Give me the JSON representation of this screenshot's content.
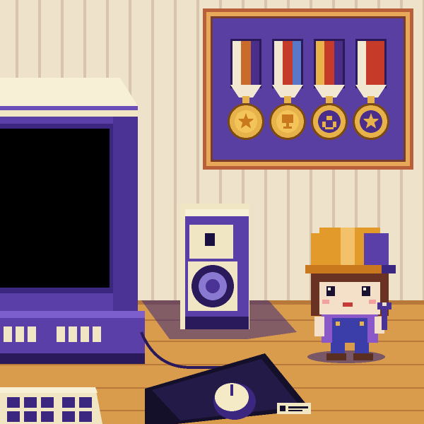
{
  "scene": {
    "title": "",
    "style": "pixel-art"
  },
  "wall": {
    "stripe_colors": [
      "#f0e4cf",
      "#d7c6ad"
    ]
  },
  "frame": {
    "medals": [
      {
        "name": "star-medal",
        "ribbon": [
          "#f2e7d0",
          "#c96b2b",
          "#4a2e8a"
        ],
        "emblem": "star"
      },
      {
        "name": "trophy-medal",
        "ribbon": [
          "#f2e7d0",
          "#c63a2a",
          "#5a78c8"
        ],
        "emblem": "trophy"
      },
      {
        "name": "laurel-medal",
        "ribbon": [
          "#e9b34a",
          "#c63a2a",
          "#4a2e8a"
        ],
        "emblem": "laurel"
      },
      {
        "name": "star-medal-blue",
        "ribbon": [
          "#f2e7d0",
          "#c63a2a",
          "#c63a2a"
        ],
        "emblem": "star-dark"
      }
    ],
    "colors": {
      "border": "#b9603a",
      "inner": "#5a3fa3",
      "gold": "#e8b24a"
    }
  },
  "palette": {
    "purple": "#5b3fa8",
    "purple_dark": "#2a1a5c",
    "cream": "#f4ebc6",
    "wood": "#d69a4a",
    "wood_dark": "#b8783a",
    "screen": "#000000",
    "helmet": "#e29a2a"
  },
  "character": {
    "type": "worker-girl",
    "tool": "wrench-icon"
  }
}
